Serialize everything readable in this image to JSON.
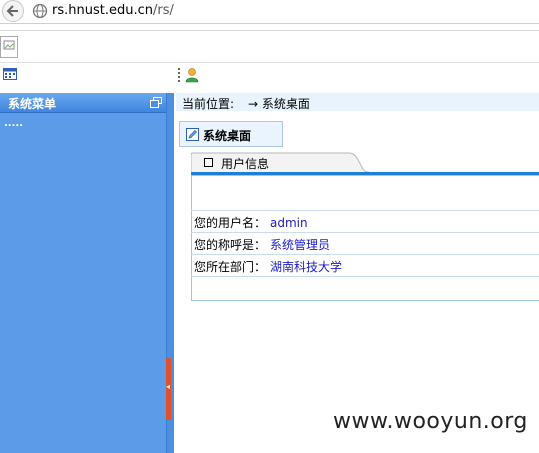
{
  "browser": {
    "url_host": "rs.hnust.edu.cn",
    "url_path": "/rs/"
  },
  "sidebar": {
    "title": "系统菜单",
    "placeholder": "....."
  },
  "breadcrumb": {
    "label": "当前位置:",
    "value": "→ 系统桌面"
  },
  "desktop_tab": {
    "title": "系统桌面"
  },
  "panel": {
    "title": "用户信息",
    "rows": [
      {
        "label": "您的用户名：",
        "value": "admin"
      },
      {
        "label": "您的称呼是：",
        "value": "系统管理员"
      },
      {
        "label": "您所在部门：",
        "value": "湖南科技大学"
      }
    ]
  },
  "watermark": "www.wooyun.org",
  "colors": {
    "sidebar": "#5b9be8",
    "accent_rule": "#1f7fd6",
    "value_text": "#1a1ac8",
    "splitter_handle": "#e1502a"
  }
}
